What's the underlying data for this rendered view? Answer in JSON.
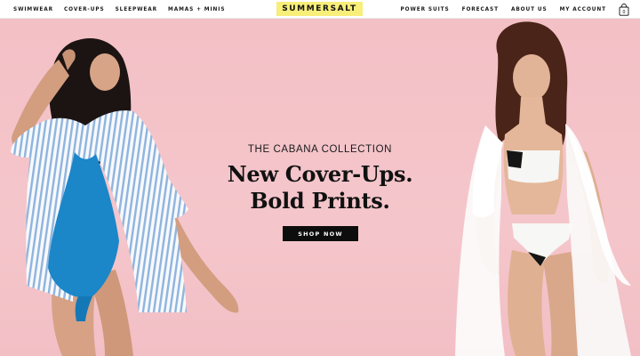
{
  "header": {
    "nav_left": [
      "SWIMWEAR",
      "COVER-UPS",
      "SLEEPWEAR",
      "MAMAS + MINIS"
    ],
    "logo": "SUMMERSALT",
    "nav_right": [
      "POWER SUITS",
      "FORECAST",
      "ABOUT US",
      "MY ACCOUNT"
    ],
    "cart_count": "0",
    "cart_icon": "shopping-bag-icon"
  },
  "hero": {
    "eyebrow": "THE CABANA COLLECTION",
    "headline_line1": "New Cover-Ups.",
    "headline_line2": "Bold Prints.",
    "cta": "SHOP NOW"
  },
  "colors": {
    "hero_background": "#f4c3c8",
    "logo_background": "#f8ee7a",
    "cta_background": "#0d0d0d"
  }
}
